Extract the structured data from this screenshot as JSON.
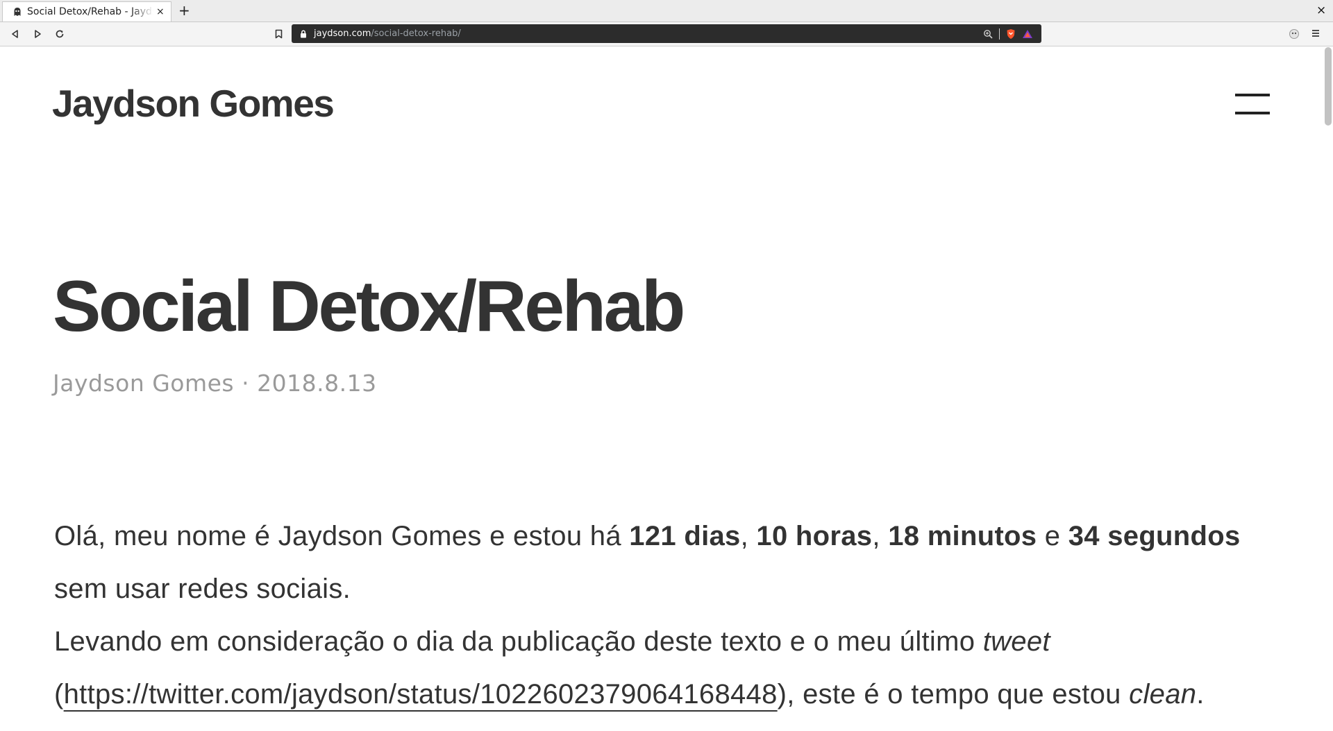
{
  "browser": {
    "tab_title": "Social Detox/Rehab - Jaydson Gomes",
    "tab_close": "×",
    "new_tab": "+",
    "window_close": "×",
    "url_domain": "jaydson.com",
    "url_path": "/social-detox-rehab/"
  },
  "site": {
    "title": "Jaydson Gomes"
  },
  "post": {
    "title": "Social Detox/Rehab",
    "author": "Jaydson Gomes",
    "separator": " · ",
    "date": "2018.8.13",
    "p1_start": "Olá, meu nome é Jaydson Gomes e estou há ",
    "p1_days": "121 dias",
    "p1_comma1": ", ",
    "p1_hours": "10 horas",
    "p1_comma2": ", ",
    "p1_minutes": "18 minutos",
    "p1_and": " e ",
    "p1_seconds": "34 segundos",
    "p1_end": " sem usar redes sociais.",
    "p2_start": "Levando em consideração o dia da publicação deste texto e o meu último ",
    "p2_tweet": "tweet",
    "p2_paren_open": " (",
    "p2_link": "https://twitter.com/jaydson/status/1022602379064168448",
    "p2_after_link": "), este é o tempo que estou ",
    "p2_clean": "clean",
    "p2_end": "."
  }
}
